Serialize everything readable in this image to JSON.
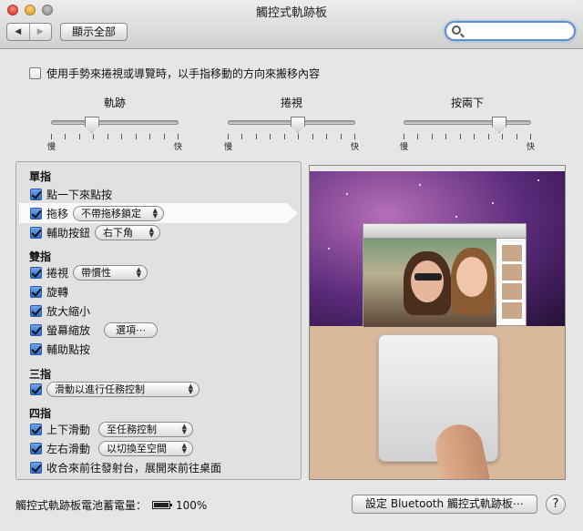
{
  "window": {
    "title": "觸控式軌跡板"
  },
  "toolbar": {
    "back_icon": "◀",
    "forward_icon": "▶",
    "show_all": "顯示全部",
    "search_value": ""
  },
  "scroll_direction": {
    "label": "使用手勢來捲視或導覽時，以手指移動的方向來搬移內容",
    "checked": false
  },
  "sliders": [
    {
      "label": "軌跡",
      "lo": "慢",
      "hi": "快",
      "value": 0.32
    },
    {
      "label": "捲視",
      "lo": "慢",
      "hi": "快",
      "value": 0.55
    },
    {
      "label": "按兩下",
      "lo": "慢",
      "hi": "快",
      "value": 0.75
    }
  ],
  "sections": {
    "one": "單指",
    "two": "雙指",
    "three": "三指",
    "four": "四指"
  },
  "options": {
    "tap_to_click": "點一下來點按",
    "drag": "拖移",
    "drag_popup": "不帶拖移鎖定",
    "secondary_click": "輔助按鈕",
    "secondary_popup": "右下角",
    "scroll": "捲視",
    "scroll_popup": "帶慣性",
    "rotate": "旋轉",
    "pinch_zoom": "放大縮小",
    "screen_zoom": "螢幕縮放",
    "screen_zoom_button": "選項⋯",
    "secondary_tap": "輔助點按",
    "three_popup": "滑動以進行任務控制",
    "swipe_updown": "上下滑動",
    "swipe_updown_popup": "至任務控制",
    "swipe_leftright": "左右滑動",
    "swipe_leftright_popup": "以切換至空間",
    "pinch_launchpad": "收合來前往發射台，展開來前往桌面"
  },
  "footer": {
    "battery_label": "觸控式軌跡板電池蓄電量：",
    "battery_value": "100%",
    "bluetooth_button": "設定 Bluetooth 觸控式軌跡板⋯",
    "help": "?"
  }
}
